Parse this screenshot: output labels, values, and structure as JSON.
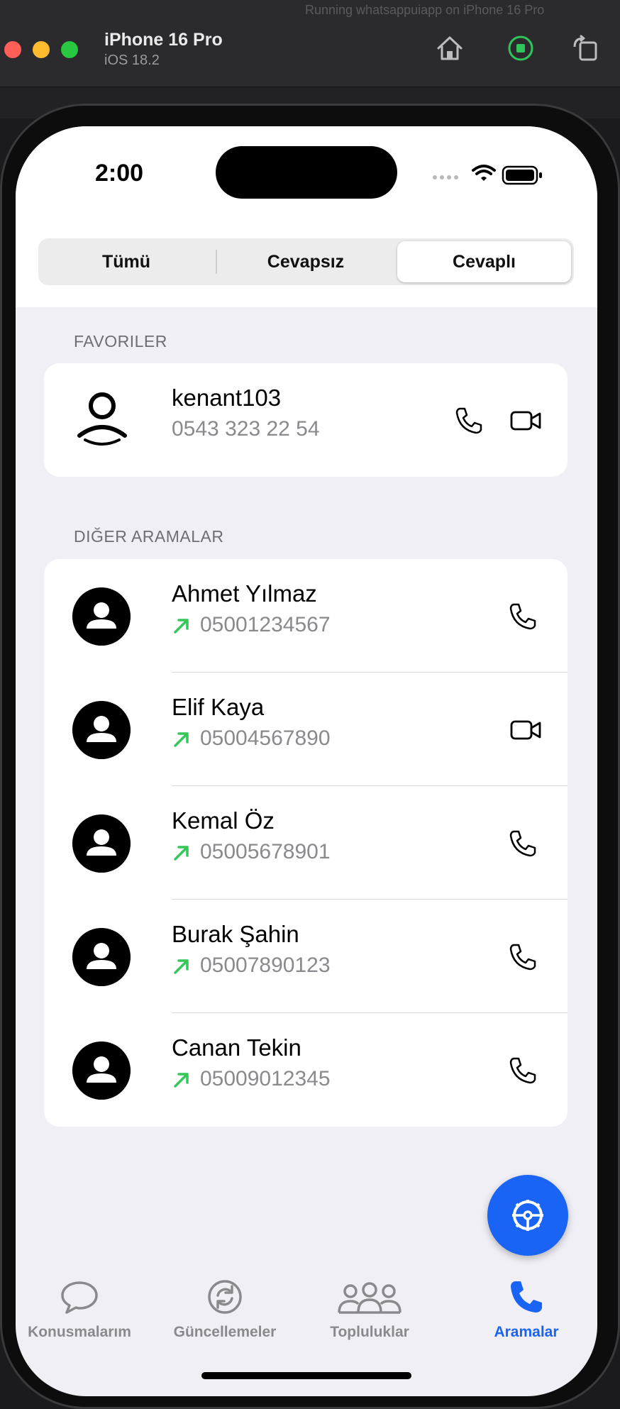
{
  "window": {
    "background_title": "Running whatsappuiapp on iPhone 16 Pro",
    "device_name": "iPhone 16 Pro",
    "os_version": "iOS 18.2"
  },
  "status_bar": {
    "time": "2:00"
  },
  "segmented": {
    "items": [
      "Tümü",
      "Cevapsız",
      "Cevaplı"
    ],
    "selected": "Cevaplı"
  },
  "favorites": {
    "label": "FAVORILER",
    "items": [
      {
        "name": "kenant103",
        "number": "0543 323 22 54",
        "actions": [
          "phone-icon",
          "video-icon"
        ]
      }
    ]
  },
  "other_calls": {
    "label": "DIĞER ARAMALAR",
    "items": [
      {
        "name": "Ahmet Yılmaz",
        "number": "05001234567",
        "direction": "outgoing",
        "action": "phone-icon"
      },
      {
        "name": "Elif Kaya",
        "number": "05004567890",
        "direction": "outgoing",
        "action": "video-icon"
      },
      {
        "name": "Kemal Öz",
        "number": "05005678901",
        "direction": "outgoing",
        "action": "phone-icon"
      },
      {
        "name": "Burak Şahin",
        "number": "05007890123",
        "direction": "outgoing",
        "action": "phone-icon"
      },
      {
        "name": "Canan Tekin",
        "number": "05009012345",
        "direction": "outgoing",
        "action": "phone-icon"
      }
    ]
  },
  "fab": {
    "icon": "steering-wheel-icon",
    "color": "#1a64f5"
  },
  "tab_bar": {
    "items": [
      {
        "label": "Konusmalarım",
        "icon": "chat-bubble-icon"
      },
      {
        "label": "Güncellemeler",
        "icon": "updates-icon"
      },
      {
        "label": "Topluluklar",
        "icon": "communities-icon"
      },
      {
        "label": "Aramalar",
        "icon": "phone-icon"
      }
    ],
    "selected": "Aramalar"
  },
  "colors": {
    "accent": "#1a64f5",
    "outgoing_arrow": "#34c759",
    "secondary_text": "#8a8a8e",
    "list_background": "#f0eff5"
  }
}
